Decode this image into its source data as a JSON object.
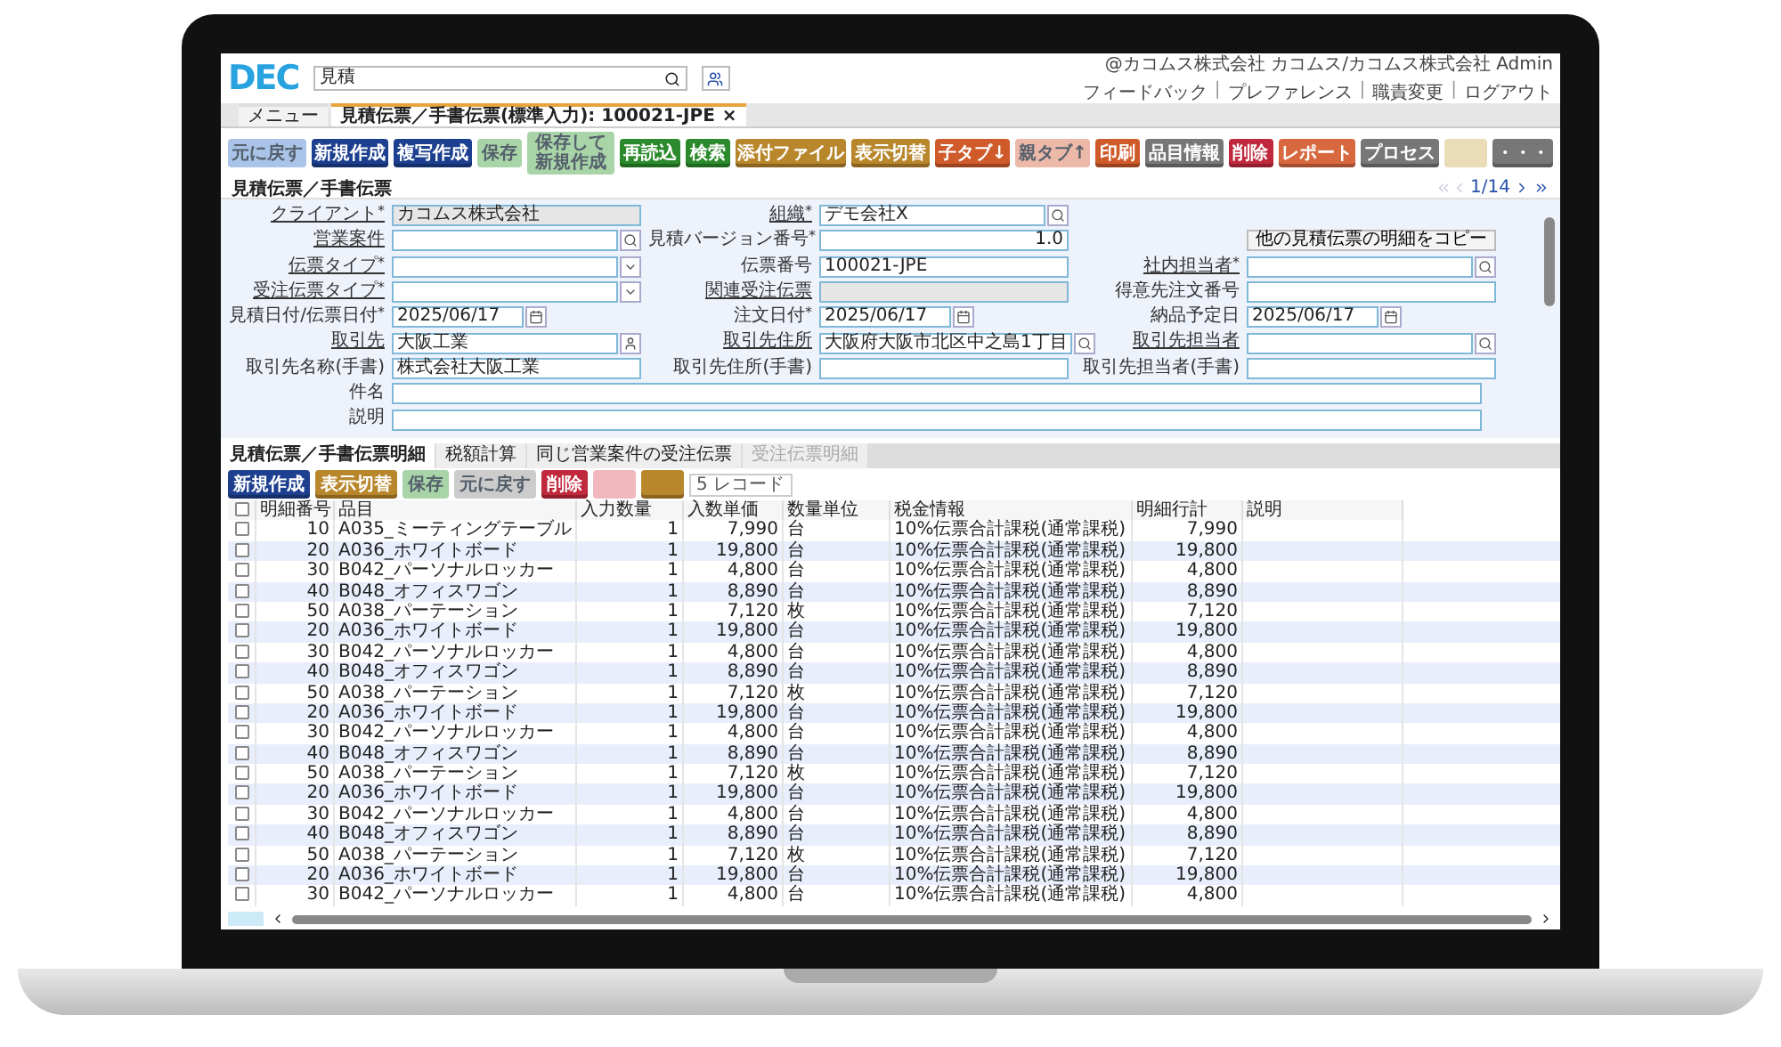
{
  "header": {
    "logo": "DEC",
    "search": "見積",
    "user": "@カコムス株式会社 カコムス/カコムス株式会社 Admin",
    "links": [
      {
        "label": "フィードバック"
      },
      {
        "separator": "|",
        "label": "プレファレンス"
      },
      {
        "separator": "|",
        "label": "職責変更"
      },
      {
        "separator": "|",
        "label": "ログアウト"
      }
    ]
  },
  "tabs": [
    {
      "label": "メニュー",
      "selected": false
    },
    {
      "label": "見積伝票／手書伝票(標準入力): 100021-JPE",
      "selected": true,
      "close": "×"
    }
  ],
  "toolbar": [
    {
      "label": "元に戻す",
      "color": "#a9c4e8",
      "disabled": true
    },
    {
      "label": "新規作成",
      "color": "#1d3f8f",
      "disabled": false
    },
    {
      "label": "複写作成",
      "color": "#1d3f8f",
      "disabled": false
    },
    {
      "label": "保存",
      "color": "#a8d4a8",
      "disabled": true
    },
    {
      "label": "保存して新規作成",
      "color": "#a8d4a8",
      "disabled": true
    },
    {
      "label": "再読込",
      "color": "#2b8a2b",
      "disabled": false
    },
    {
      "label": "検索",
      "color": "#2b8a2b",
      "disabled": false
    },
    {
      "label": "添付ファイル",
      "color": "#b8862b",
      "disabled": false
    },
    {
      "label": "表示切替",
      "color": "#b8862b",
      "disabled": false
    },
    {
      "label": "子タブ↓",
      "color": "#cf5a2a",
      "disabled": false
    },
    {
      "label": "親タブ↑",
      "color": "#ecb8a8",
      "disabled": true
    },
    {
      "label": "印刷",
      "color": "#cf5a2a",
      "disabled": false
    },
    {
      "label": "品目情報",
      "color": "#777777",
      "disabled": false
    },
    {
      "label": "削除",
      "color": "#c0283c",
      "disabled": false
    },
    {
      "label": "レポート",
      "color": "#d8693f",
      "disabled": false
    },
    {
      "label": "プロセス",
      "color": "#777777",
      "disabled": false
    },
    {
      "color": "#ebdcb8",
      "disabled": true
    },
    {
      "label": "・・・",
      "color": "#777777",
      "disabled": false
    }
  ],
  "breadcrumb": "見積伝票／手書伝票",
  "pager": "1/14",
  "form": [
    {
      "left": {
        "label": "クライアント",
        "link": true,
        "mark": "*",
        "kind": "readonly",
        "value": "カコムス株式会社"
      },
      "middle": {
        "label": "組織",
        "link": true,
        "mark": "*",
        "kind": "search",
        "value": "デモ会社X"
      }
    },
    {
      "left": {
        "label": "営業案件",
        "link": true,
        "kind": "search"
      },
      "middle": {
        "label": "見積バージョン番号",
        "link": false,
        "mark": "*",
        "kind": "number",
        "value": "1.0"
      },
      "right": {
        "kind": "button",
        "label": "他の見積伝票の明細をコピー"
      }
    },
    {
      "left": {
        "label": "伝票タイプ",
        "link": true,
        "mark": "*",
        "kind": "select"
      },
      "middle": {
        "label": "伝票番号",
        "link": false,
        "kind": "text",
        "value": "100021-JPE"
      },
      "right": {
        "label": "社内担当者",
        "link": true,
        "mark": "*",
        "kind": "search"
      }
    },
    {
      "left": {
        "label": "受注伝票タイプ",
        "link": true,
        "mark": "*",
        "kind": "select"
      },
      "middle": {
        "label": "関連受注伝票",
        "link": true,
        "kind": "readonly"
      },
      "right": {
        "label": "得意先注文番号",
        "link": false,
        "kind": "text"
      }
    },
    {
      "left": {
        "label": "見積日付/伝票日付",
        "link": false,
        "mark": "*",
        "kind": "date",
        "value": "2025/06/17"
      },
      "middle": {
        "label": "注文日付",
        "link": false,
        "mark": "*",
        "kind": "date",
        "value": "2025/06/17"
      },
      "right": {
        "label": "納品予定日",
        "link": false,
        "kind": "date",
        "value": "2025/06/17"
      }
    },
    {
      "left": {
        "label": "取引先",
        "link": true,
        "kind": "person",
        "value": "大阪工業"
      },
      "middle": {
        "label": "取引先住所",
        "link": true,
        "kind": "search",
        "value": "大阪府大阪市北区中之島1丁目"
      },
      "right": {
        "label": "取引先担当者",
        "link": true,
        "kind": "search"
      }
    },
    {
      "left": {
        "label": "取引先名称(手書)",
        "link": false,
        "kind": "text",
        "value": "株式会社大阪工業"
      },
      "middle": {
        "label": "取引先住所(手書)",
        "link": false,
        "kind": "text"
      },
      "right": {
        "label": "取引先担当者(手書)",
        "link": false,
        "kind": "text"
      }
    },
    {
      "wide": {
        "label": "件名",
        "link": false,
        "kind": "text"
      }
    },
    {
      "wide": {
        "label": "説明",
        "link": false,
        "kind": "text"
      }
    }
  ],
  "detail_tabs": [
    {
      "label": "見積伝票／手書伝票明細",
      "selected": true,
      "disabled": false
    },
    {
      "label": "税額計算",
      "selected": false,
      "disabled": false
    },
    {
      "label": "同じ営業案件の受注伝票",
      "selected": false,
      "disabled": false
    },
    {
      "label": "受注伝票明細",
      "selected": false,
      "disabled": true
    }
  ],
  "detail_toolbar": [
    {
      "label": "新規作成",
      "color": "#1d3f8f",
      "disabled": false
    },
    {
      "label": "表示切替",
      "color": "#b8862b",
      "disabled": false
    },
    {
      "label": "保存",
      "color": "#a8d4a8",
      "disabled": true
    },
    {
      "label": "元に戻す",
      "color": "#cccccc",
      "disabled": true
    },
    {
      "label": "削除",
      "color": "#c0283c",
      "disabled": false
    },
    {
      "color": "#f0b8bc",
      "disabled": true
    },
    {
      "color": "#b8862b",
      "disabled": false
    }
  ],
  "record_count": "5 レコード",
  "table": {
    "select_all": {
      "checked": false
    },
    "columns": [
      "明細番号",
      "品目",
      "入力数量",
      "入数単価",
      "数量単位",
      "税金情報",
      "明細行計",
      "説明"
    ],
    "rows": [
      {
        "no": "10",
        "item": "A035_ミーティングテーブル",
        "qty": "1",
        "price": "7,990",
        "unit": "台",
        "tax": "10%伝票合計課税(通常課税)",
        "total": "7,990",
        "checked": false
      },
      {
        "no": "20",
        "item": "A036_ホワイトボード",
        "qty": "1",
        "price": "19,800",
        "unit": "台",
        "tax": "10%伝票合計課税(通常課税)",
        "total": "19,800",
        "checked": false
      },
      {
        "no": "30",
        "item": "B042_パーソナルロッカー",
        "qty": "1",
        "price": "4,800",
        "unit": "台",
        "tax": "10%伝票合計課税(通常課税)",
        "total": "4,800",
        "checked": false
      },
      {
        "no": "40",
        "item": "B048_オフィスワゴン",
        "qty": "1",
        "price": "8,890",
        "unit": "台",
        "tax": "10%伝票合計課税(通常課税)",
        "total": "8,890",
        "checked": false
      },
      {
        "no": "50",
        "item": "A038_パーテーション",
        "qty": "1",
        "price": "7,120",
        "unit": "枚",
        "tax": "10%伝票合計課税(通常課税)",
        "total": "7,120",
        "checked": false
      },
      {
        "no": "20",
        "item": "A036_ホワイトボード",
        "qty": "1",
        "price": "19,800",
        "unit": "台",
        "tax": "10%伝票合計課税(通常課税)",
        "total": "19,800",
        "checked": false
      },
      {
        "no": "30",
        "item": "B042_パーソナルロッカー",
        "qty": "1",
        "price": "4,800",
        "unit": "台",
        "tax": "10%伝票合計課税(通常課税)",
        "total": "4,800",
        "checked": false
      },
      {
        "no": "40",
        "item": "B048_オフィスワゴン",
        "qty": "1",
        "price": "8,890",
        "unit": "台",
        "tax": "10%伝票合計課税(通常課税)",
        "total": "8,890",
        "checked": false
      },
      {
        "no": "50",
        "item": "A038_パーテーション",
        "qty": "1",
        "price": "7,120",
        "unit": "枚",
        "tax": "10%伝票合計課税(通常課税)",
        "total": "7,120",
        "checked": false
      },
      {
        "no": "20",
        "item": "A036_ホワイトボード",
        "qty": "1",
        "price": "19,800",
        "unit": "台",
        "tax": "10%伝票合計課税(通常課税)",
        "total": "19,800",
        "checked": false
      },
      {
        "no": "30",
        "item": "B042_パーソナルロッカー",
        "qty": "1",
        "price": "4,800",
        "unit": "台",
        "tax": "10%伝票合計課税(通常課税)",
        "total": "4,800",
        "checked": false
      },
      {
        "no": "40",
        "item": "B048_オフィスワゴン",
        "qty": "1",
        "price": "8,890",
        "unit": "台",
        "tax": "10%伝票合計課税(通常課税)",
        "total": "8,890",
        "checked": false
      },
      {
        "no": "50",
        "item": "A038_パーテーション",
        "qty": "1",
        "price": "7,120",
        "unit": "枚",
        "tax": "10%伝票合計課税(通常課税)",
        "total": "7,120",
        "checked": false
      },
      {
        "no": "20",
        "item": "A036_ホワイトボード",
        "qty": "1",
        "price": "19,800",
        "unit": "台",
        "tax": "10%伝票合計課税(通常課税)",
        "total": "19,800",
        "checked": false
      },
      {
        "no": "30",
        "item": "B042_パーソナルロッカー",
        "qty": "1",
        "price": "4,800",
        "unit": "台",
        "tax": "10%伝票合計課税(通常課税)",
        "total": "4,800",
        "checked": false
      },
      {
        "no": "40",
        "item": "B048_オフィスワゴン",
        "qty": "1",
        "price": "8,890",
        "unit": "台",
        "tax": "10%伝票合計課税(通常課税)",
        "total": "8,890",
        "checked": false
      },
      {
        "no": "50",
        "item": "A038_パーテーション",
        "qty": "1",
        "price": "7,120",
        "unit": "枚",
        "tax": "10%伝票合計課税(通常課税)",
        "total": "7,120",
        "checked": false
      },
      {
        "no": "20",
        "item": "A036_ホワイトボード",
        "qty": "1",
        "price": "19,800",
        "unit": "台",
        "tax": "10%伝票合計課税(通常課税)",
        "total": "19,800",
        "checked": false
      },
      {
        "no": "30",
        "item": "B042_パーソナルロッカー",
        "qty": "1",
        "price": "4,800",
        "unit": "台",
        "tax": "10%伝票合計課税(通常課税)",
        "total": "4,800",
        "checked": false
      }
    ]
  }
}
